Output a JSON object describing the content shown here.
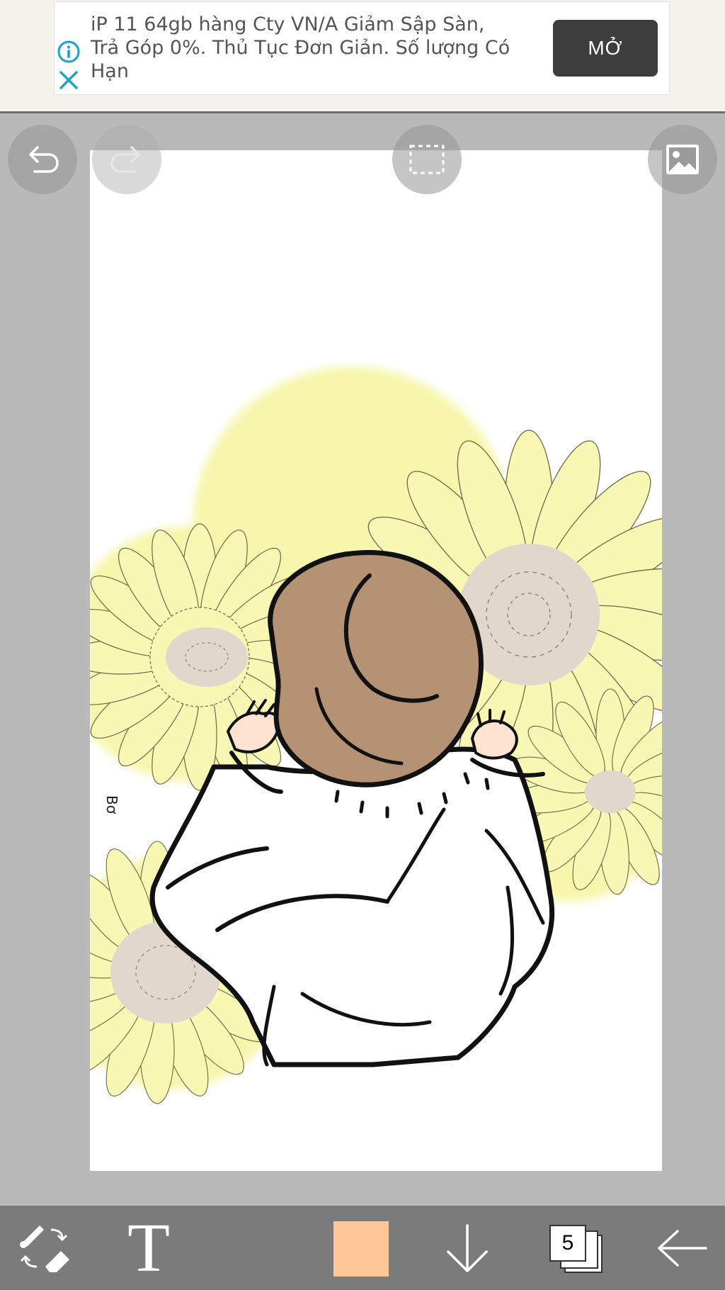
{
  "ad": {
    "text": "iP 11 64gb hàng Cty VN/A Giảm Sập Sàn, Trả Góp 0%. Thủ Tục Đơn Giản. Số lượng Có Hạn",
    "open_button_label": "MỞ",
    "info_icon": "info-icon",
    "close_icon": "close-icon"
  },
  "canvas_actions": {
    "undo_icon": "undo-icon",
    "redo_icon": "redo-icon",
    "selection_icon": "selection-icon",
    "image_icon": "image-icon"
  },
  "artwork": {
    "signature": "Bơ",
    "colors": {
      "petal": "#f8f7b4",
      "petal_glow": "#f1ef6b",
      "flower_center": "#e2d7cc",
      "hair": "#b69274",
      "skin": "#ffe3d2",
      "outline": "#111111"
    }
  },
  "toolbar": {
    "brush_eraser_icon": "brush-eraser-swap-icon",
    "text_tool_label": "T",
    "current_color": "#ffc89b",
    "layer_down_icon": "arrow-down-icon",
    "layers_count": "5",
    "back_icon": "arrow-left-icon"
  }
}
